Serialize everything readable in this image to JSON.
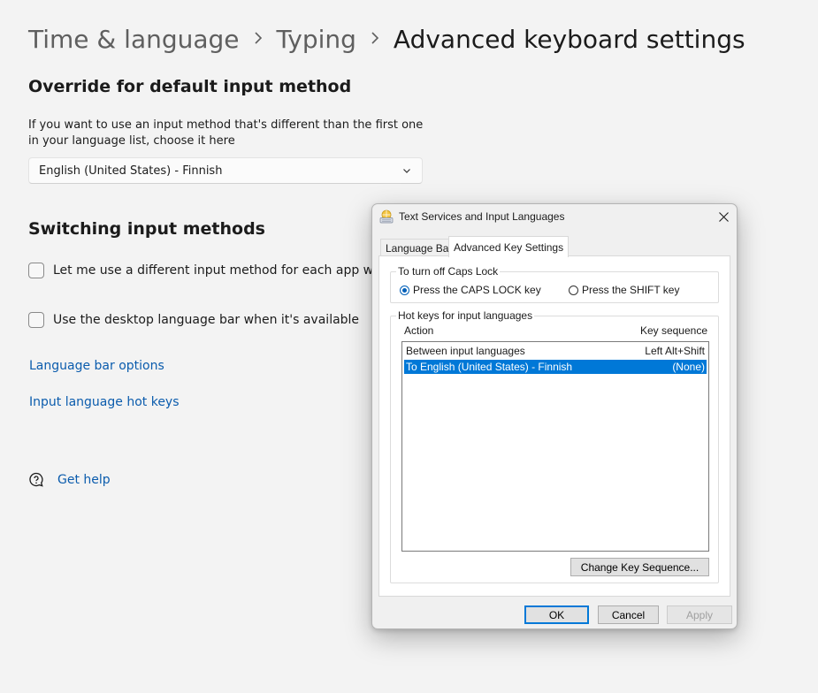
{
  "breadcrumb": {
    "parent1": "Time & language",
    "parent2": "Typing",
    "current": "Advanced keyboard settings",
    "separator_icon": "chevron-right-icon"
  },
  "override": {
    "title": "Override for default input method",
    "description": "If you want to use an input method that's different than the first one in your language list, choose it here",
    "selected_value": "English (United States) - Finnish"
  },
  "switching": {
    "title": "Switching input methods",
    "options": [
      {
        "label": "Let me use a different input method for each app window",
        "checked": false
      },
      {
        "label": "Use the desktop language bar when it's available",
        "checked": false
      }
    ]
  },
  "links": {
    "language_bar_options": "Language bar options",
    "input_language_hot_keys": "Input language hot keys",
    "get_help": "Get help"
  },
  "dialog": {
    "title": "Text Services and Input Languages",
    "tabs": [
      {
        "label": "Language Bar",
        "active": false
      },
      {
        "label": "Advanced Key Settings",
        "active": true
      }
    ],
    "caps_lock": {
      "group_label": "To turn off Caps Lock",
      "options": [
        {
          "label": "Press the CAPS LOCK key",
          "checked": true
        },
        {
          "label": "Press the SHIFT key",
          "checked": false
        }
      ]
    },
    "hotkeys": {
      "group_label": "Hot keys for input languages",
      "col_action": "Action",
      "col_sequence": "Key sequence",
      "rows": [
        {
          "action": "Between input languages",
          "sequence": "Left Alt+Shift",
          "selected": false
        },
        {
          "action": "To English (United States) - Finnish",
          "sequence": "(None)",
          "selected": true
        }
      ],
      "change_button": "Change Key Sequence..."
    },
    "buttons": {
      "ok": "OK",
      "cancel": "Cancel",
      "apply": "Apply"
    }
  },
  "colors": {
    "background": "#f3f3f3",
    "link": "#0b5cad",
    "accent": "#0078d7"
  }
}
